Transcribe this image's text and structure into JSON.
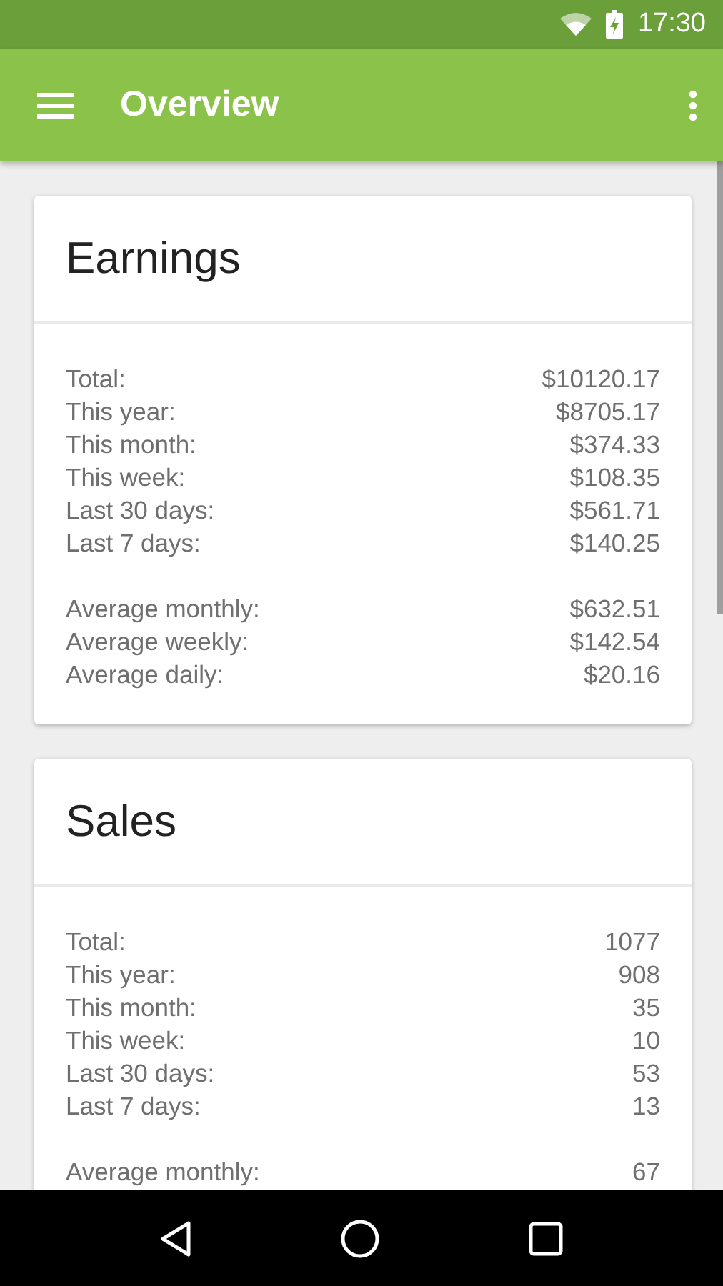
{
  "status_bar": {
    "time": "17:30"
  },
  "app_bar": {
    "title": "Overview"
  },
  "cards": [
    {
      "title": "Earnings",
      "groups": [
        [
          {
            "label": "Total:",
            "value": "$10120.17"
          },
          {
            "label": "This year:",
            "value": "$8705.17"
          },
          {
            "label": "This month:",
            "value": "$374.33"
          },
          {
            "label": "This week:",
            "value": "$108.35"
          },
          {
            "label": "Last 30 days:",
            "value": "$561.71"
          },
          {
            "label": "Last 7 days:",
            "value": "$140.25"
          }
        ],
        [
          {
            "label": "Average monthly:",
            "value": "$632.51"
          },
          {
            "label": "Average weekly:",
            "value": "$142.54"
          },
          {
            "label": "Average daily:",
            "value": "$20.16"
          }
        ]
      ]
    },
    {
      "title": "Sales",
      "groups": [
        [
          {
            "label": "Total:",
            "value": "1077"
          },
          {
            "label": "This year:",
            "value": "908"
          },
          {
            "label": "This month:",
            "value": "35"
          },
          {
            "label": "This week:",
            "value": "10"
          },
          {
            "label": "Last 30 days:",
            "value": "53"
          },
          {
            "label": "Last 7 days:",
            "value": "13"
          }
        ],
        [
          {
            "label": "Average monthly:",
            "value": "67"
          }
        ]
      ]
    }
  ]
}
